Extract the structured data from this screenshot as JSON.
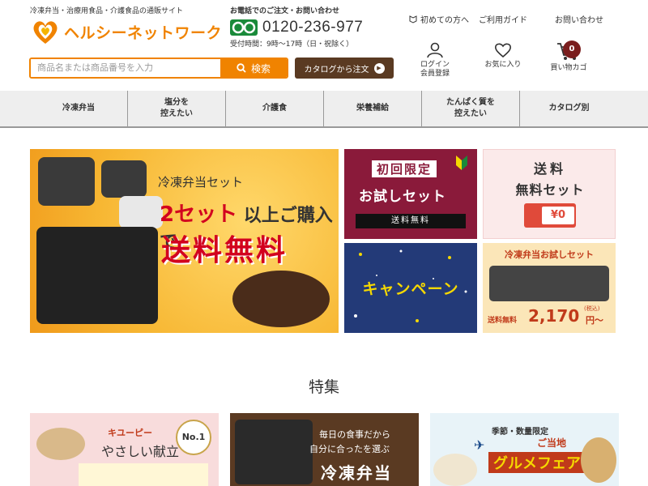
{
  "header": {
    "tagline": "冷凍弁当・治療用食品・介護食品の通販サイト",
    "logo_text": "ヘルシーネットワーク",
    "phone_caption": "お電話でのご注文・お問い合わせ",
    "phone_number": "0120-236-977",
    "phone_hours": "受付時間：9時〜17時（日・祝除く）",
    "top_links": [
      "初めての方へ",
      "ご利用ガイド",
      "お問い合わせ"
    ],
    "search_placeholder": "商品名または商品番号を入力",
    "search_button": "検索",
    "catalog_button": "カタログから注文",
    "login_label_1": "ログイン",
    "login_label_2": "会員登録",
    "favorites_label": "お気に入り",
    "cart_label": "買い物カゴ",
    "cart_count": "0"
  },
  "nav": {
    "items": [
      "冷凍弁当",
      "塩分を\n控えたい",
      "介護食",
      "栄養補給",
      "たんぱく質を\n控えたい",
      "カタログ別"
    ]
  },
  "banners": {
    "main_title": "冷凍弁当セット",
    "main_num": "2セット",
    "main_sub": "以上ご購入で",
    "main_free": "送料無料",
    "trial_title_1": "初回限定",
    "trial_title_2": "お試しセット",
    "trial_free": "送料無料",
    "free_set_1": "送料",
    "free_set_2": "無料セット",
    "free_set_truck": "¥0",
    "campaign": "キャンペーン",
    "osame_title": "冷凍弁当お試しセット",
    "osame_free": "送料無料",
    "osame_price": "2,170",
    "osame_tax": "(税込)",
    "osame_unit": "円〜"
  },
  "features": {
    "section_title": "特集",
    "card1_brand": "キユーピー",
    "card1_title": "やさしい献立",
    "card1_badge": "No.1",
    "card2_text_1": "毎日の食事だから",
    "card2_text_2": "自分に合ったを選ぶ",
    "card2_title": "冷凍弁当",
    "card3_top": "季節・数量限定",
    "card3_title": "グルメフェア",
    "card3_badge": "ご当地"
  },
  "colors": {
    "accent": "#f08300",
    "catalog": "#5a3a22",
    "cart_badge": "#7a1e1e",
    "free_red": "#d2001f"
  }
}
